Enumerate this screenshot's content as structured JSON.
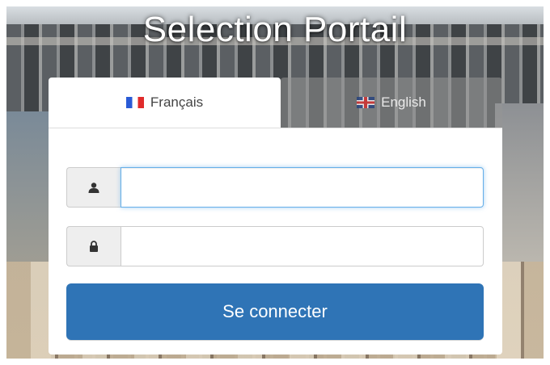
{
  "page": {
    "title": "Selection Portail"
  },
  "tabs": [
    {
      "label": "Français",
      "flag": "france-flag-icon",
      "active": true
    },
    {
      "label": "English",
      "flag": "uk-flag-icon",
      "active": false
    }
  ],
  "form": {
    "username": {
      "value": "",
      "placeholder": "",
      "icon": "user-icon"
    },
    "password": {
      "value": "",
      "placeholder": "",
      "icon": "lock-icon"
    },
    "submit_label": "Se connecter"
  },
  "colors": {
    "primary_button": "#2f74b6",
    "focus_border": "#66afe9"
  }
}
